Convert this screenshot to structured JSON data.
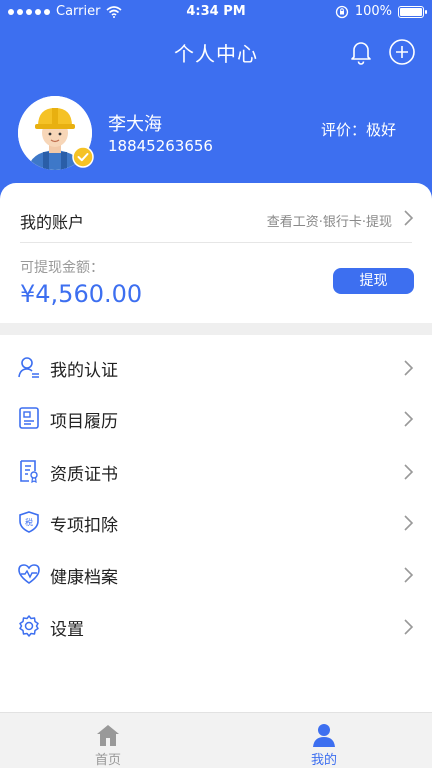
{
  "status_bar": {
    "carrier": "Carrier",
    "time": "4:34 PM",
    "battery": "100%"
  },
  "header": {
    "title": "个人中心"
  },
  "user": {
    "name": "李大海",
    "phone": "18845263656",
    "rating": "评价：极好"
  },
  "account": {
    "title": "我的账户",
    "link": "查看工资·银行卡·提现",
    "balance_label": "可提现金额：",
    "balance": "¥4,560.00",
    "withdraw_label": "提现"
  },
  "menu": [
    {
      "label": "我的认证",
      "icon": "user-verify-icon"
    },
    {
      "label": "项目履历",
      "icon": "project-history-icon"
    },
    {
      "label": "资质证书",
      "icon": "certificate-icon"
    },
    {
      "label": "专项扣除",
      "icon": "tax-shield-icon"
    },
    {
      "label": "健康档案",
      "icon": "health-heartbeat-icon"
    },
    {
      "label": "设置",
      "icon": "gear-icon"
    }
  ],
  "tabs": [
    {
      "label": "首页",
      "icon": "home-icon",
      "active": false
    },
    {
      "label": "我的",
      "icon": "person-icon",
      "active": true
    }
  ],
  "colors": {
    "primary": "#3d6ff0",
    "helmet": "#f5c225",
    "separator": "#efefef"
  }
}
